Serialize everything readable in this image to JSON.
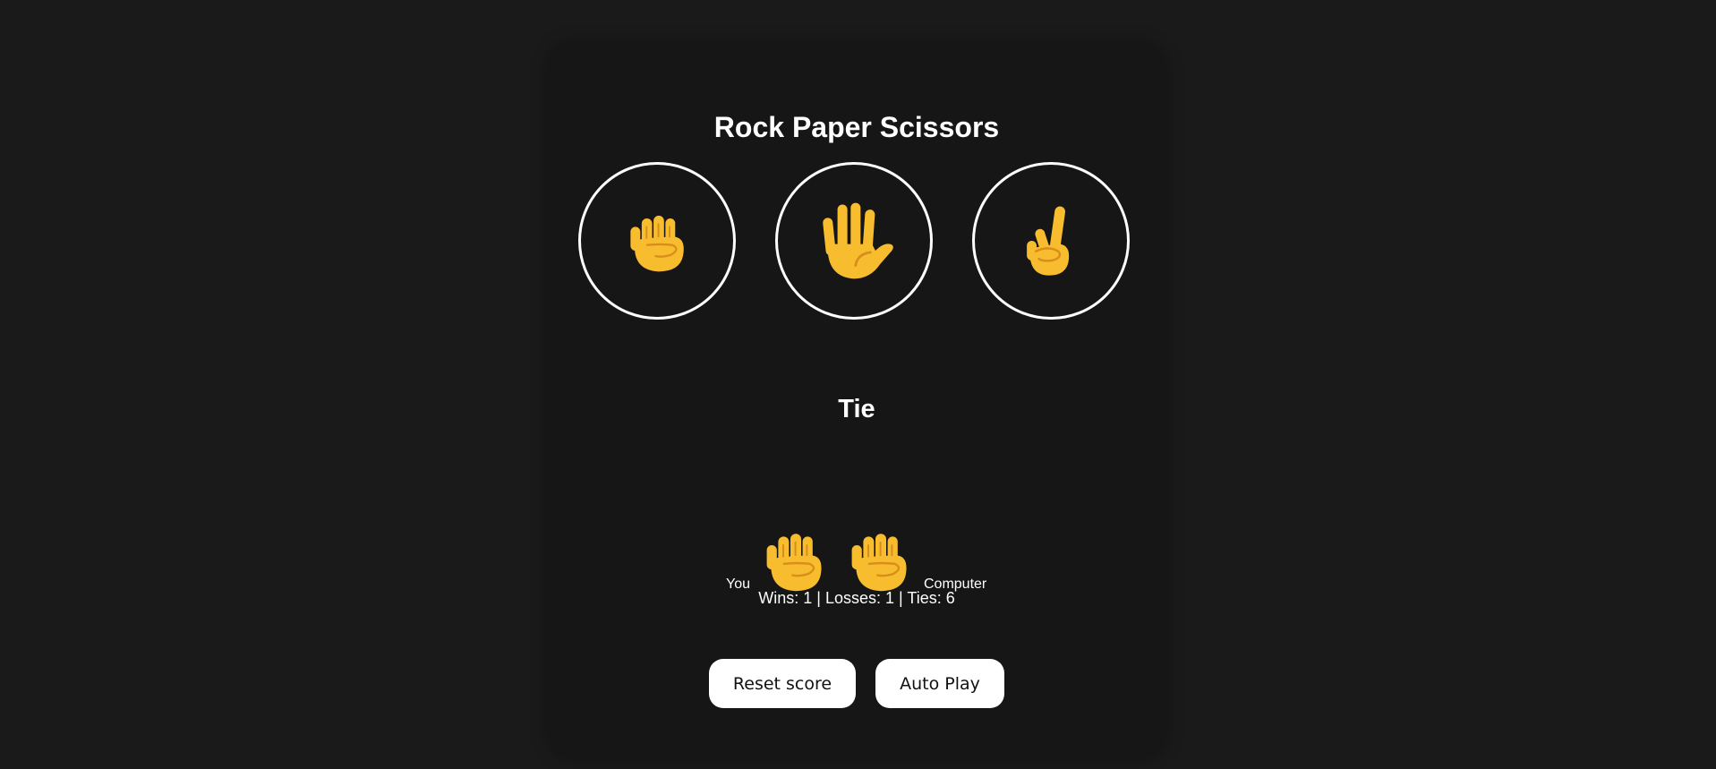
{
  "game": {
    "title": "Rock Paper Scissors",
    "moves": [
      {
        "id": "rock",
        "icon": "fist-icon"
      },
      {
        "id": "paper",
        "icon": "raised-hand-icon"
      },
      {
        "id": "scissors",
        "icon": "victory-hand-icon"
      }
    ],
    "result": "Tie",
    "player_label": "You",
    "computer_label": "Computer",
    "player_move_icon": "fist-icon",
    "computer_move_icon": "fist-icon",
    "score_text": "Wins: 1 | Losses: 1 | Ties: 6",
    "reset_label": "Reset score",
    "autoplay_label": "Auto Play"
  },
  "colors": {
    "background": "#1a1a1a",
    "card": "#161616",
    "hand_fill": "#f8bd2f",
    "hand_stroke": "#d98e1c",
    "button_bg": "#ffffff"
  }
}
